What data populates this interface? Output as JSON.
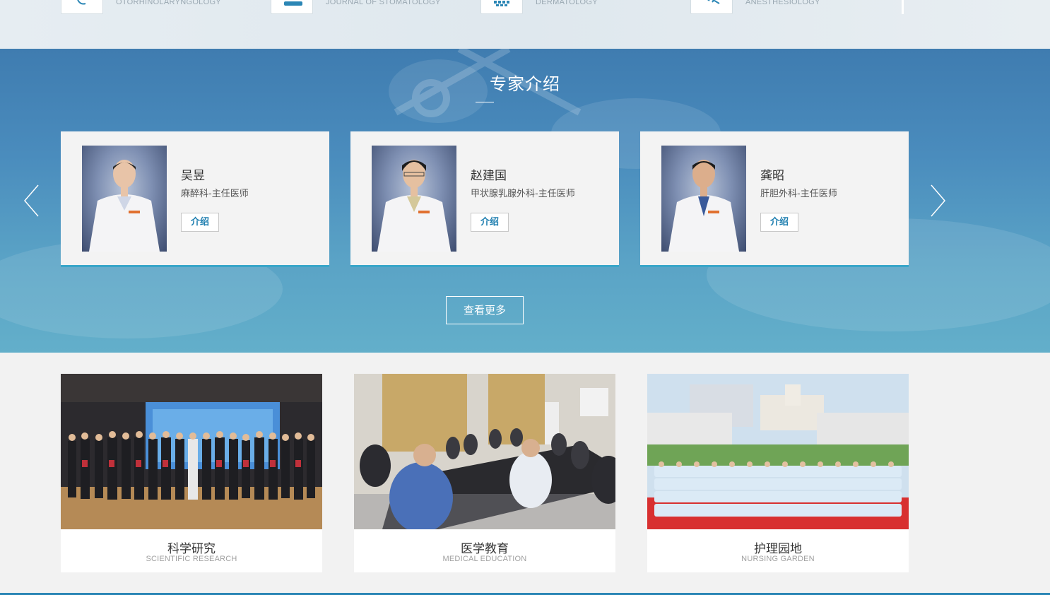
{
  "departments": [
    {
      "name": "OTORHINOLARYNGOLOGY",
      "icon": "ear-icon"
    },
    {
      "name": "JOURNAL OF STOMATOLOGY",
      "icon": "dental-chair-icon"
    },
    {
      "name": "DERMATOLOGY",
      "icon": "skin-cells-icon"
    },
    {
      "name": "ANESTHESIOLOGY",
      "icon": "syringe-icon"
    }
  ],
  "experts_section": {
    "title": "专家介绍",
    "more_label": "查看更多",
    "cards": [
      {
        "name": "吴昱",
        "title": "麻醉科-主任医师",
        "button": "介绍"
      },
      {
        "name": "赵建国",
        "title": "甲状腺乳腺外科-主任医师",
        "button": "介绍"
      },
      {
        "name": "龚昭",
        "title": "肝胆外科-主任医师",
        "button": "介绍"
      }
    ]
  },
  "features": [
    {
      "title": "科学研究",
      "subtitle": "SCIENTIFIC RESEARCH"
    },
    {
      "title": "医学教育",
      "subtitle": "MEDICAL EDUCATION"
    },
    {
      "title": "护理园地",
      "subtitle": "NURSING GARDEN"
    }
  ],
  "colors": {
    "accent": "#39a6c9",
    "section_bg": "#4a8cbd",
    "link": "#1f7fb0"
  }
}
